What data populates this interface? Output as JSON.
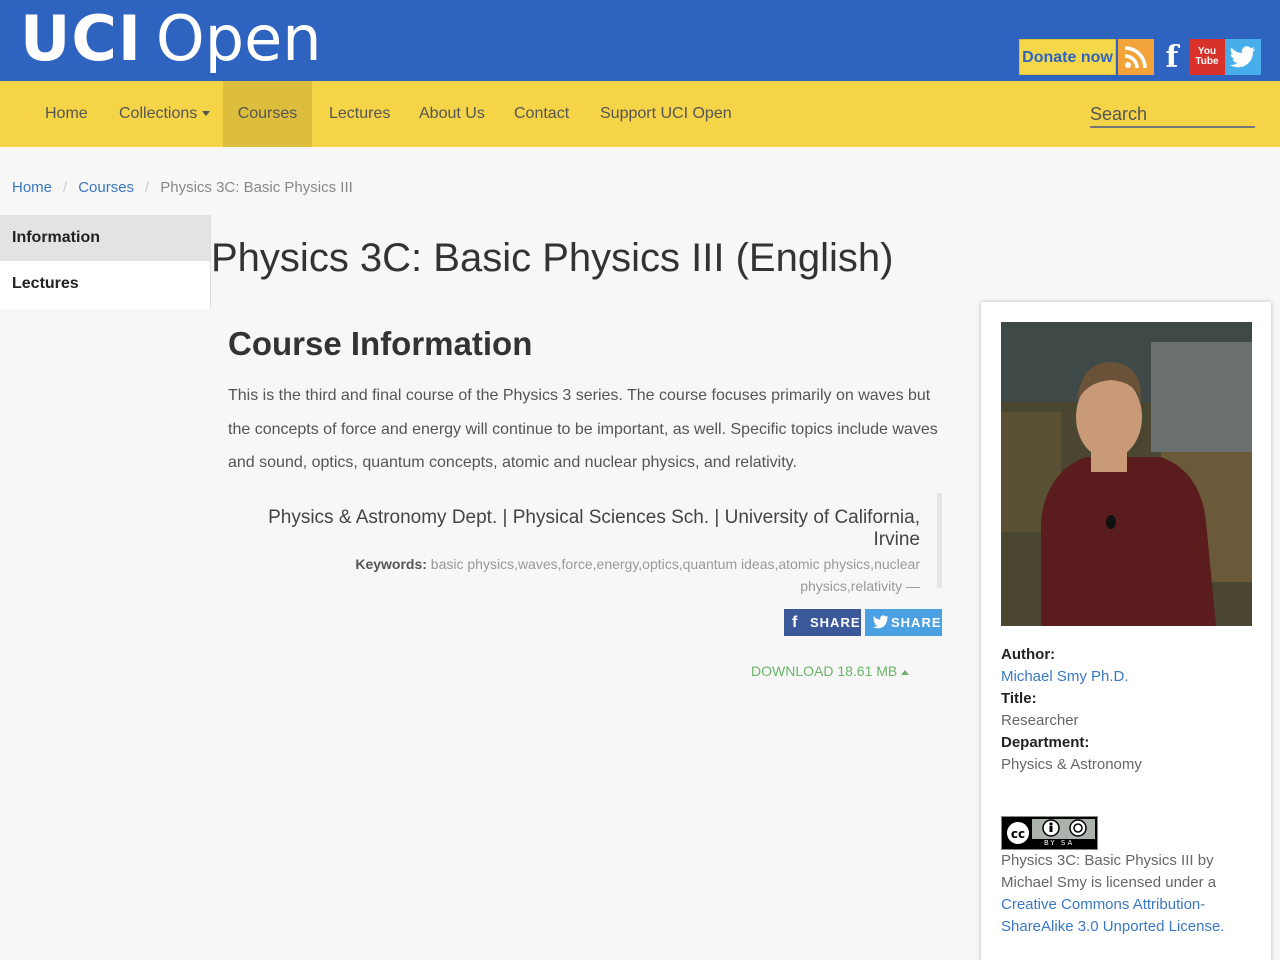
{
  "header": {
    "logo_bold": "UCI",
    "logo_light": "Open",
    "donate_label": "Donate now",
    "social": [
      "rss-icon",
      "facebook-icon",
      "youtube-icon",
      "twitter-icon"
    ],
    "youtube_text": "You Tube"
  },
  "nav": {
    "items": [
      {
        "label": "Home"
      },
      {
        "label": "Collections"
      },
      {
        "label": "Courses"
      },
      {
        "label": "Lectures"
      },
      {
        "label": "About Us"
      },
      {
        "label": "Contact"
      },
      {
        "label": "Support UCI Open"
      }
    ],
    "active": "Courses",
    "search_placeholder": "Search"
  },
  "breadcrumb": {
    "items": [
      "Home",
      "Courses"
    ],
    "separator": "/",
    "current": "Physics 3C: Basic Physics III"
  },
  "sidetabs": [
    "Information",
    "Lectures"
  ],
  "main": {
    "title": "Physics 3C: Basic Physics III (English)",
    "section_title": "Course Information",
    "description": "This is the third and final course of the Physics 3 series. The course focuses primarily on waves but the concepts of force and energy will continue to be important, as well. Specific topics include waves and sound, optics, quantum concepts, atomic and nuclear physics, and relativity.",
    "affiliation": "Physics & Astronomy Dept. | Physical Sciences Sch. | University of California, Irvine",
    "keywords_label": "Keywords:",
    "keywords": "basic physics,waves,force,energy,optics,quantum ideas,atomic physics,nuclear physics,relativity —",
    "share_facebook": "SHARE",
    "share_twitter": "SHARE",
    "download": "DOWNLOAD 18.61 MB"
  },
  "author": {
    "author_label": "Author:",
    "author_name": "Michael Smy Ph.D.",
    "title_label": "Title:",
    "title_value": "Researcher",
    "department_label": "Department:",
    "department_value": "Physics & Astronomy",
    "cc_badge_text": "BY SA",
    "license_text": "Physics 3C: Basic Physics III by Michael Smy is licensed under a",
    "license_link": "Creative Commons Attribution-ShareAlike 3.0 Unported License."
  },
  "colors": {
    "header_blue": "#2f63c0",
    "nav_yellow": "#f5d448",
    "link_blue": "#3a78c3",
    "download_green": "#6bb56b"
  }
}
